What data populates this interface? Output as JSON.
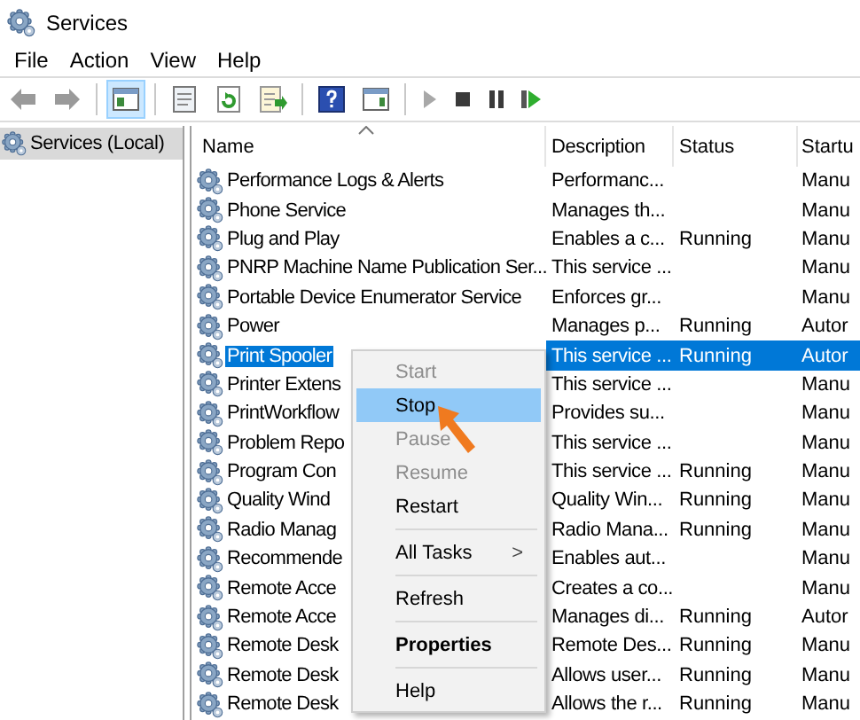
{
  "window": {
    "title": "Services"
  },
  "menu_bar": [
    "File",
    "Action",
    "View",
    "Help"
  ],
  "toolbar": {
    "console_tree_button": {
      "selected": true
    }
  },
  "tree": {
    "items": [
      {
        "label": "Services (Local)",
        "selected": true
      }
    ]
  },
  "table": {
    "columns": [
      "Name",
      "Description",
      "Status",
      "Startu"
    ],
    "rows": [
      {
        "name": "Performance Logs & Alerts",
        "description": "Performanc...",
        "status": "",
        "startup": "Manu",
        "selected": false
      },
      {
        "name": "Phone Service",
        "description": "Manages th...",
        "status": "",
        "startup": "Manu",
        "selected": false
      },
      {
        "name": "Plug and Play",
        "description": "Enables a c...",
        "status": "Running",
        "startup": "Manu",
        "selected": false
      },
      {
        "name": "PNRP Machine Name Publication Ser...",
        "description": "This service ...",
        "status": "",
        "startup": "Manu",
        "selected": false
      },
      {
        "name": "Portable Device Enumerator Service",
        "description": "Enforces gr...",
        "status": "",
        "startup": "Manu",
        "selected": false
      },
      {
        "name": "Power",
        "description": "Manages p...",
        "status": "Running",
        "startup": "Autor",
        "selected": false
      },
      {
        "name": "Print Spooler",
        "description": "This service ...",
        "status": "Running",
        "startup": "Autor",
        "selected": true
      },
      {
        "name": "Printer Extens",
        "description": "This service ...",
        "status": "",
        "startup": "Manu",
        "selected": false
      },
      {
        "name": "PrintWorkflow",
        "description": "Provides su...",
        "status": "",
        "startup": "Manu",
        "selected": false
      },
      {
        "name": "Problem Repo",
        "description": "This service ...",
        "status": "",
        "startup": "Manu",
        "selected": false
      },
      {
        "name": "Program Con",
        "description": "This service ...",
        "status": "Running",
        "startup": "Manu",
        "selected": false
      },
      {
        "name": "Quality Wind",
        "description": "Quality Win...",
        "status": "Running",
        "startup": "Manu",
        "selected": false
      },
      {
        "name": "Radio Manag",
        "description": "Radio Mana...",
        "status": "Running",
        "startup": "Manu",
        "selected": false
      },
      {
        "name": "Recommende",
        "description": "Enables aut...",
        "status": "",
        "startup": "Manu",
        "selected": false
      },
      {
        "name": "Remote Acce",
        "description": "Creates a co...",
        "status": "",
        "startup": "Manu",
        "selected": false
      },
      {
        "name": "Remote Acce",
        "description": "Manages di...",
        "status": "Running",
        "startup": "Autor",
        "selected": false
      },
      {
        "name": "Remote Desk",
        "description": "Remote Des...",
        "status": "Running",
        "startup": "Manu",
        "selected": false
      },
      {
        "name": "Remote Desk",
        "description": "Allows user...",
        "status": "Running",
        "startup": "Manu",
        "selected": false
      },
      {
        "name": "Remote Desk",
        "description": "Allows the r...",
        "status": "Running",
        "startup": "Manu",
        "selected": false
      }
    ]
  },
  "context_menu": {
    "items": [
      {
        "kind": "item",
        "label": "Start",
        "disabled": true,
        "selected": false
      },
      {
        "kind": "item",
        "label": "Stop",
        "disabled": false,
        "selected": true
      },
      {
        "kind": "item",
        "label": "Pause",
        "disabled": true,
        "selected": false
      },
      {
        "kind": "item",
        "label": "Resume",
        "disabled": true,
        "selected": false
      },
      {
        "kind": "item",
        "label": "Restart",
        "disabled": false,
        "selected": false
      },
      {
        "kind": "separator"
      },
      {
        "kind": "submenu",
        "label": "All Tasks",
        "arrow": ">",
        "disabled": false,
        "selected": false
      },
      {
        "kind": "separator"
      },
      {
        "kind": "item",
        "label": "Refresh",
        "disabled": false,
        "selected": false
      },
      {
        "kind": "separator"
      },
      {
        "kind": "default",
        "label": "Properties",
        "disabled": false,
        "selected": false
      },
      {
        "kind": "separator"
      },
      {
        "kind": "item",
        "label": "Help",
        "disabled": false,
        "selected": false
      }
    ]
  }
}
